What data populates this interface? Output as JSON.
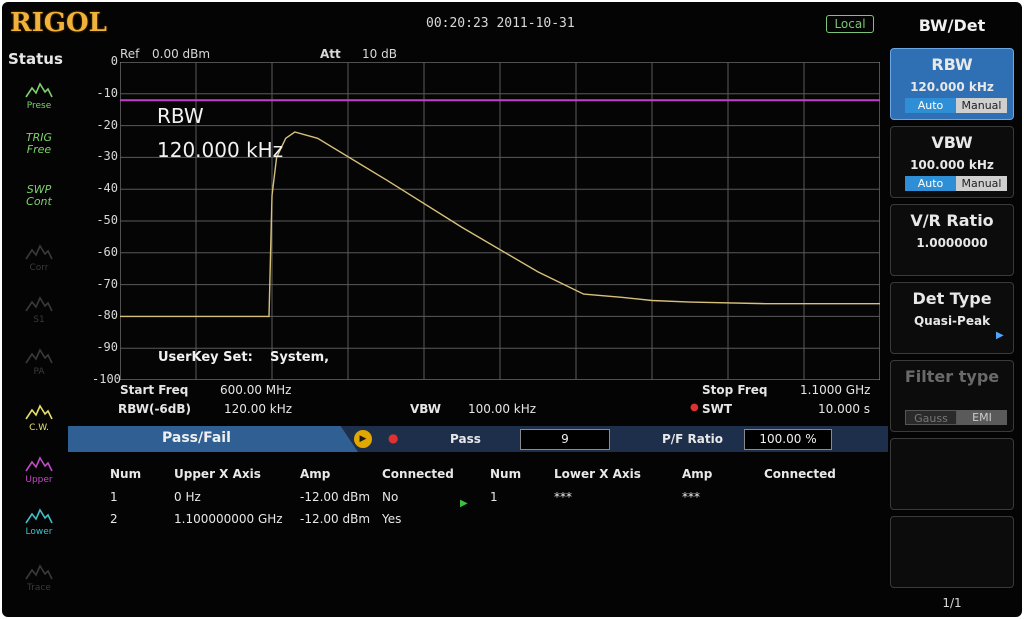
{
  "header": {
    "brand": "RIGOL",
    "datetime": "00:20:23 2011-10-31",
    "mode_badge": "Local"
  },
  "status": {
    "title": "Status",
    "items": [
      {
        "label": "Prese",
        "icon": "mountain-icon",
        "color": "#7cd36a"
      },
      {
        "label": "TRIG\nFree",
        "icon": "trigger-text-icon",
        "color": "#7cd36a"
      },
      {
        "label": "SWP\nCont",
        "icon": "sweep-text-icon",
        "color": "#7cd36a"
      },
      {
        "label": "Corr",
        "icon": "correction-icon",
        "color": "#3a3a3a"
      },
      {
        "label": "S1",
        "icon": "sweep-mode-icon",
        "color": "#3a3a3a"
      },
      {
        "label": "PA",
        "icon": "preamp-icon",
        "color": "#3a3a3a"
      },
      {
        "label": "C.W.",
        "icon": "wave-icon",
        "color": "#e6e06a"
      },
      {
        "label": "Upper",
        "icon": "upper-wave-icon",
        "color": "#c04bc6"
      },
      {
        "label": "Lower",
        "icon": "lower-wave-icon",
        "color": "#3fc0c8"
      },
      {
        "label": "Trace",
        "icon": "trace-wave-icon",
        "color": "#3a3a3a"
      }
    ]
  },
  "measurement": {
    "ref_label": "Ref",
    "ref_value": "0.00 dBm",
    "att_label": "Att",
    "att_value": "10 dB",
    "rbw_annotation": "RBW",
    "rbw_annotation_value": "120.000 kHz",
    "userkey_label": "UserKey Set:",
    "userkey_value": "System,"
  },
  "footer": {
    "start_freq_label": "Start Freq",
    "start_freq_value": "600.00 MHz",
    "rbw_label": "RBW(-6dB)",
    "rbw_value": "120.00 kHz",
    "vbw_label": "VBW",
    "vbw_value": "100.00 kHz",
    "stop_freq_label": "Stop Freq",
    "stop_freq_value": "1.1000 GHz",
    "swt_label": "SWT",
    "swt_value": "10.000 s"
  },
  "pass_fail": {
    "title": "Pass/Fail",
    "pass_label": "Pass",
    "pass_value": "9",
    "ratio_label": "P/F Ratio",
    "ratio_value": "100.00 %",
    "upper_headers": [
      "Num",
      "Upper X Axis",
      "Amp",
      "Connected"
    ],
    "lower_headers": [
      "Num",
      "Lower X Axis",
      "Amp",
      "Connected"
    ],
    "upper_rows": [
      [
        "1",
        "0 Hz",
        "-12.00 dBm",
        "No"
      ],
      [
        "2",
        "1.100000000 GHz",
        "-12.00 dBm",
        "Yes"
      ]
    ],
    "lower_rows": [
      [
        "1",
        "***",
        "***",
        ""
      ]
    ]
  },
  "menu": {
    "title": "BW/Det",
    "buttons": [
      {
        "label": "RBW",
        "value": "120.000 kHz",
        "seg": [
          "Auto",
          "Manual"
        ],
        "active": true
      },
      {
        "label": "VBW",
        "value": "100.000 kHz",
        "seg": [
          "Auto",
          "Manual"
        ],
        "active": false
      },
      {
        "label": "V/R Ratio",
        "value": "1.0000000",
        "active": false
      },
      {
        "label": "Det Type",
        "value": "Quasi-Peak",
        "active": false
      },
      {
        "label": "Filter type",
        "seg": [
          "Gauss",
          "EMI"
        ],
        "disabled": true
      }
    ],
    "page": "1/1"
  },
  "chart_data": {
    "type": "line",
    "ylabel_ticks": [
      "0",
      "-10",
      "-20",
      "-30",
      "-40",
      "-50",
      "-60",
      "-70",
      "-80",
      "-90",
      "-100"
    ],
    "ylim": [
      -100,
      0
    ],
    "xlim": [
      "600.00 MHz",
      "1.1000 GHz"
    ],
    "grid": true,
    "series": [
      {
        "values": [
          [
            0,
            -80
          ],
          [
            0.196,
            -80
          ],
          [
            0.2,
            -42
          ],
          [
            0.206,
            -30
          ],
          [
            0.218,
            -24
          ],
          [
            0.23,
            -22
          ],
          [
            0.26,
            -24
          ],
          [
            0.35,
            -37
          ],
          [
            0.45,
            -52
          ],
          [
            0.55,
            -66
          ],
          [
            0.61,
            -73
          ],
          [
            0.66,
            -74
          ],
          [
            0.7,
            -75
          ],
          [
            0.75,
            -75.5
          ],
          [
            0.85,
            -76
          ],
          [
            1.0,
            -76
          ]
        ],
        "color": "#d7c07a"
      },
      {
        "values": [
          [
            0,
            -12
          ],
          [
            1.0,
            -12
          ]
        ],
        "color": "#c23fc8"
      }
    ],
    "x_unit": "fraction of span"
  }
}
